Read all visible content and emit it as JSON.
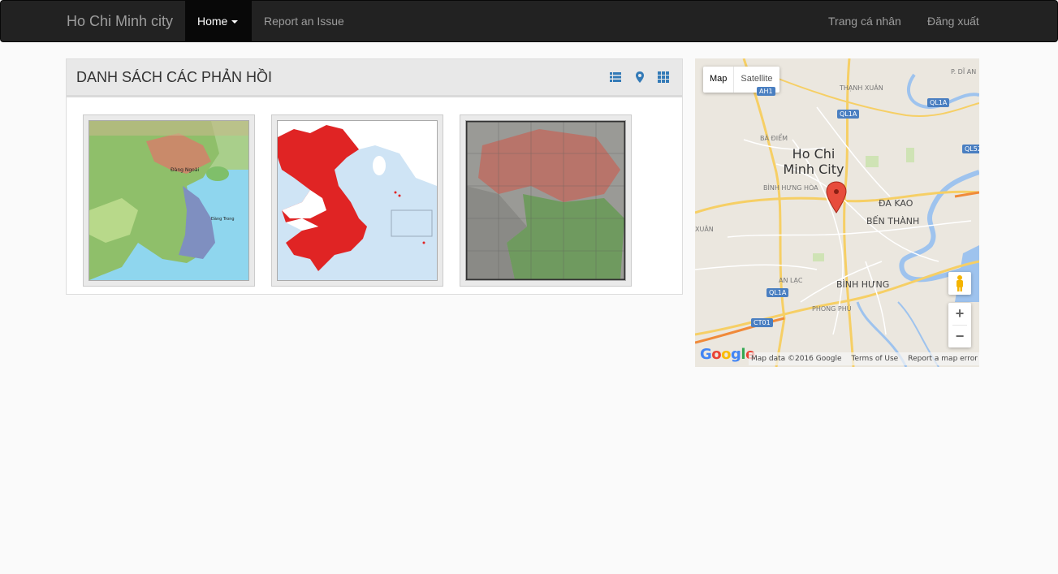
{
  "navbar": {
    "brand": "Ho Chi Minh city",
    "home_label": "Home",
    "report_label": "Report an Issue",
    "profile_label": "Trang cá nhân",
    "logout_label": "Đăng xuất"
  },
  "panel": {
    "title": "DANH SÁCH CÁC PHẢN HỒI",
    "view_buttons": [
      "list-view-icon",
      "map-pin-icon",
      "grid-view-icon"
    ],
    "thumbnails": [
      {
        "name": "vietnam-historical-map-thumbnail",
        "labels": [
          "Đàng Ngoài",
          "Đàng Trong"
        ]
      },
      {
        "name": "vietnam-red-map-thumbnail"
      },
      {
        "name": "vietnam-old-photo-map-thumbnail"
      }
    ],
    "accent": "#337ab7"
  },
  "map": {
    "type_map": "Map",
    "type_satellite": "Satellite",
    "city_label": "Ho Chi Minh City",
    "district_labels": {
      "thanh_xuan": "THẠNH XUÂN",
      "ba_diem": "BÀ ĐIỂM",
      "binh_hung_hoa": "BÌNH HƯNG HÒA",
      "da_kao": "ĐA KAO",
      "ben_thanh": "BẾN THÀNH",
      "an_lac": "AN LẠC",
      "binh_hung": "BÌNH HƯNG",
      "phong_phu": "PHONG PHÚ",
      "xuan": "XUÂN",
      "p_di_an": "P. DĨ AN"
    },
    "road_shields": [
      "AH1",
      "QL1A",
      "QL1A",
      "QL52",
      "QL1A",
      "CT01"
    ],
    "zoom_in": "+",
    "zoom_out": "−",
    "logo": "Google",
    "attribution": "Map data ©2016 Google",
    "terms": "Terms of Use",
    "report_error": "Report a map error"
  }
}
